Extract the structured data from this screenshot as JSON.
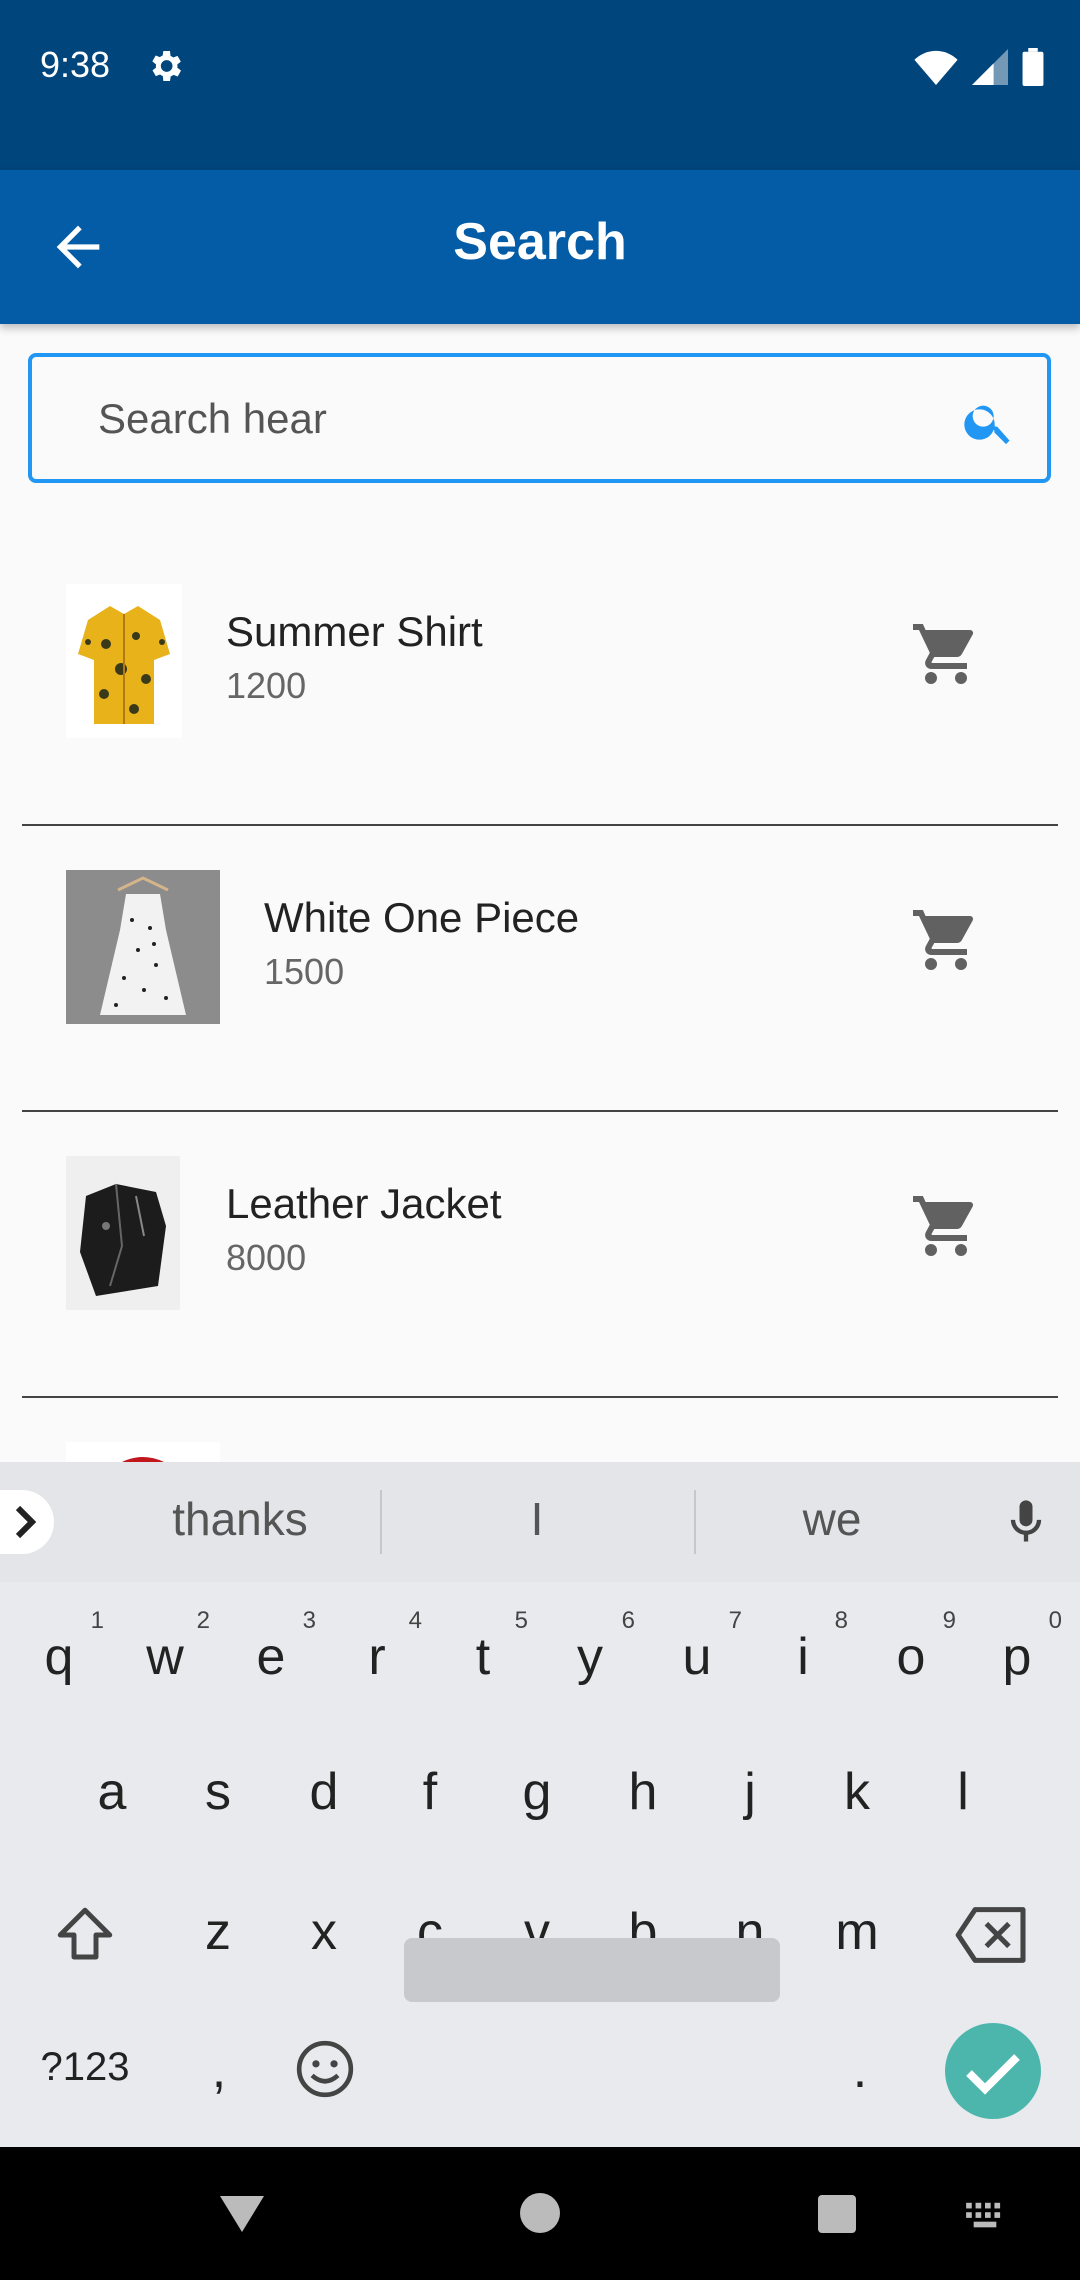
{
  "status_bar": {
    "time": "9:38",
    "icons": [
      "gear-icon",
      "wifi-icon",
      "signal-icon",
      "battery-icon"
    ]
  },
  "app_bar": {
    "title": "Search",
    "back_icon": "arrow-left-icon"
  },
  "search": {
    "placeholder": "Search hear",
    "value": "",
    "icon": "search-icon"
  },
  "products": [
    {
      "name": "Summer Shirt",
      "price": "1200"
    },
    {
      "name": "White One Piece",
      "price": "1500"
    },
    {
      "name": "Leather Jacket",
      "price": "8000"
    }
  ],
  "keyboard": {
    "suggestions": [
      "thanks",
      "I",
      "we"
    ],
    "row1": [
      {
        "k": "q",
        "n": "1"
      },
      {
        "k": "w",
        "n": "2"
      },
      {
        "k": "e",
        "n": "3"
      },
      {
        "k": "r",
        "n": "4"
      },
      {
        "k": "t",
        "n": "5"
      },
      {
        "k": "y",
        "n": "6"
      },
      {
        "k": "u",
        "n": "7"
      },
      {
        "k": "i",
        "n": "8"
      },
      {
        "k": "o",
        "n": "9"
      },
      {
        "k": "p",
        "n": "0"
      }
    ],
    "row2": [
      "a",
      "s",
      "d",
      "f",
      "g",
      "h",
      "j",
      "k",
      "l"
    ],
    "row3": [
      "z",
      "x",
      "c",
      "v",
      "b",
      "n",
      "m"
    ],
    "symbols_label": "?123",
    "comma": ",",
    "period": "."
  },
  "colors": {
    "status_bar": "#00457c",
    "app_bar": "#035ca5",
    "accent": "#2196f3",
    "enter": "#4db6ac"
  }
}
